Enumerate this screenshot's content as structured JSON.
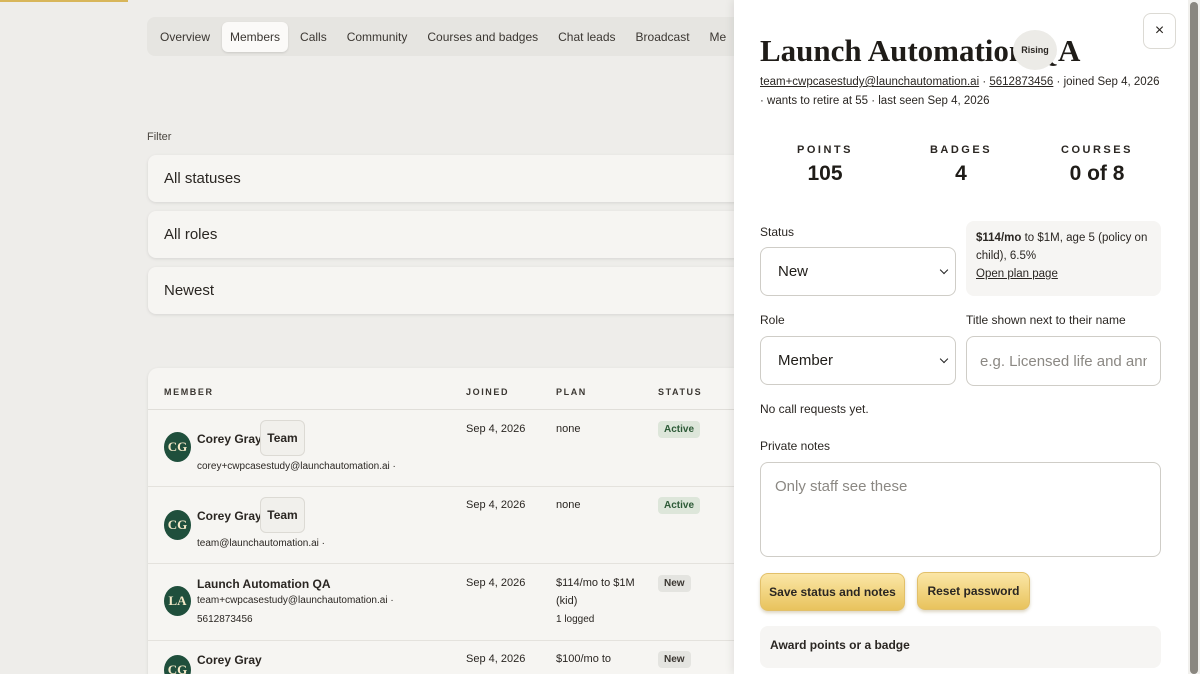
{
  "tabs": [
    "Overview",
    "Members",
    "Calls",
    "Community",
    "Courses and badges",
    "Chat leads",
    "Broadcast",
    "Me"
  ],
  "active_tab": "Members",
  "filter": {
    "label": "Filter",
    "status": "All statuses",
    "role": "All roles",
    "sort": "Newest"
  },
  "table": {
    "headers": {
      "member": "MEMBER",
      "joined": "JOINED",
      "plan": "PLAN",
      "status": "STATUS"
    },
    "rows": [
      {
        "initials": "CG",
        "name": "Corey Gray",
        "chip": "Team",
        "email": "corey+cwpcasestudy@launchautomation.ai ·",
        "phone": "",
        "joined": "Sep 4, 2026",
        "plan_line1": "none",
        "plan_line2": "",
        "plan_line3": "",
        "status": "Active"
      },
      {
        "initials": "CG",
        "name": "Corey Gray",
        "chip": "Team",
        "email": "team@launchautomation.ai ·",
        "phone": "",
        "joined": "Sep 4, 2026",
        "plan_line1": "none",
        "plan_line2": "",
        "plan_line3": "",
        "status": "Active"
      },
      {
        "initials": "LA",
        "name": "Launch Automation QA",
        "chip": "",
        "email": "team+cwpcasestudy@launchautomation.ai ·",
        "phone": "5612873456",
        "joined": "Sep 4, 2026",
        "plan_line1": "$114/mo to $1M",
        "plan_line2": "(kid)",
        "plan_line3": "1 logged",
        "status": "New"
      },
      {
        "initials": "CG",
        "name": "Corey Gray",
        "chip": "",
        "email": "",
        "phone": "",
        "joined": "Sep 4, 2026",
        "plan_line1": "$100/mo to",
        "plan_line2": "",
        "plan_line3": "",
        "status": "New"
      }
    ]
  },
  "drawer": {
    "title": "Launch Automation QA",
    "badge": "Rising",
    "email": "team+cwpcasestudy@launchautomation.ai",
    "phone": "5612873456",
    "joined_text": "· joined Sep 4, 2026",
    "sep": "·",
    "meta_line2": "· wants to retire at 55 · last seen Sep 4, 2026",
    "stats": {
      "points_label": "POINTS",
      "points": "105",
      "badges_label": "BADGES",
      "badges": "4",
      "courses_label": "COURSES",
      "courses": "0 of 8"
    },
    "status_label": "Status",
    "status_value": "New",
    "role_label": "Role",
    "role_value": "Member",
    "plan": {
      "price": "$114/mo",
      "rest": " to $1M, age 5 (policy on child), 6.5%",
      "link": "Open plan page"
    },
    "title_label": "Title shown next to their name",
    "title_placeholder": "e.g. Licensed life and annuity agent",
    "no_calls": "No call requests yet.",
    "notes_label": "Private notes",
    "notes_placeholder": "Only staff see these",
    "save_button": "Save status and notes",
    "reset_button": "Reset password",
    "award_label": "Award points or a badge",
    "close_symbol": "×"
  },
  "colors": {
    "accent_gold": "#e8c35d",
    "avatar_green": "#1f4f3c",
    "status_active_bg": "#dde6da",
    "status_new_bg": "#e4e4e0"
  }
}
